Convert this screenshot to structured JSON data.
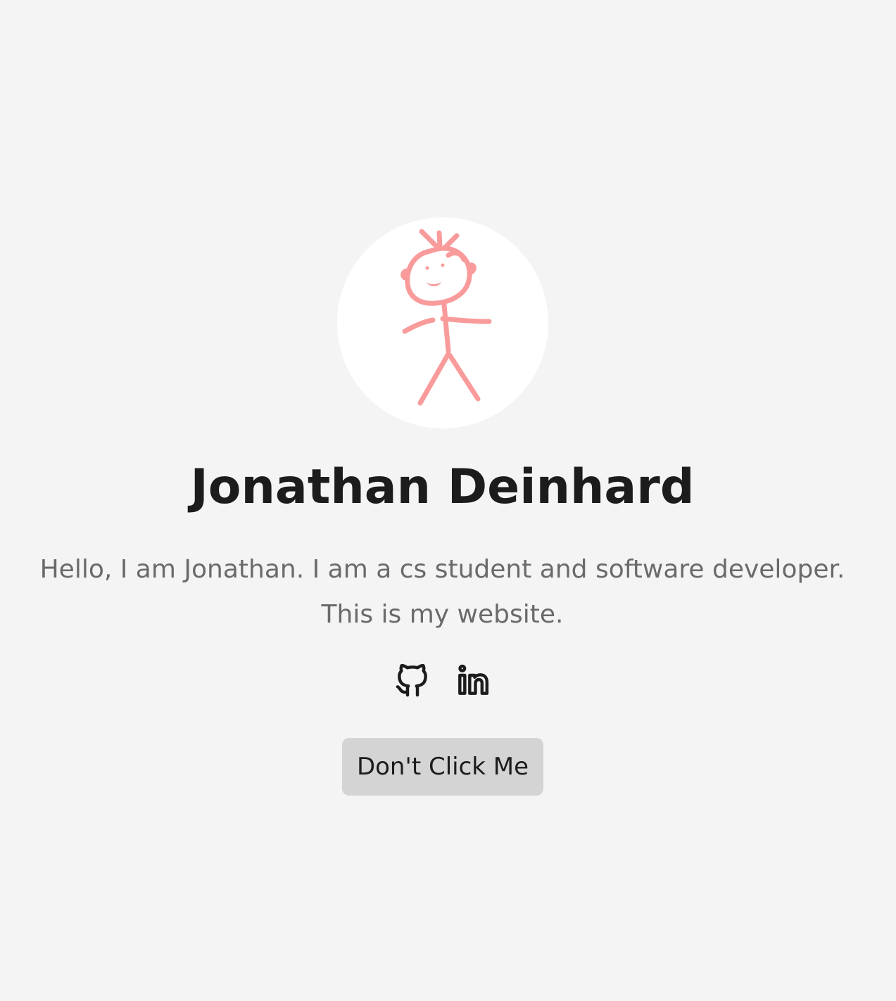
{
  "profile": {
    "avatar_icon": "stick-figure-icon",
    "name": "Jonathan Deinhard",
    "intro_line_1": "Hello, I am Jonathan. I am a cs student and software developer.",
    "intro_line_2": "This is my website."
  },
  "social": {
    "github_icon": "github-icon",
    "linkedin_icon": "linkedin-icon"
  },
  "cta": {
    "label": "Don't Click Me"
  },
  "colors": {
    "background": "#f4f4f4",
    "avatar_bg": "#ffffff",
    "figure_stroke": "#f99b9b",
    "heading": "#1c1c1c",
    "body_text": "#6a6a6a",
    "button_bg": "#d4d4d4"
  }
}
